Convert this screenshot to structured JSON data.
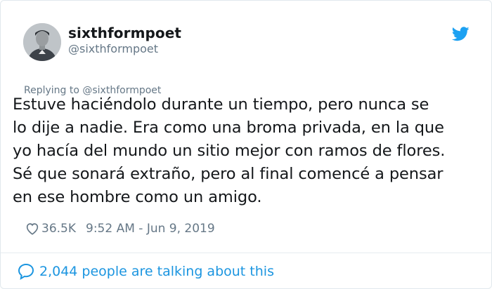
{
  "tweet": {
    "author": {
      "display_name": "sixthformpoet",
      "handle": "@sixthformpoet"
    },
    "replying_to": "Replying to @sixthformpoet",
    "text_lines": [
      "Estuve haciéndolo durante un tiempo, pero nunca se",
      "lo dije a nadie. Era como una broma privada, en la que",
      "yo hacía del mundo un sitio mejor con ramos de flores.",
      "Sé que sonará extraño, pero al final comencé a pensar",
      "en ese hombre como un amigo."
    ],
    "likes": "36.5K",
    "timestamp": "9:52 AM - Jun 9, 2019",
    "conversation": "2,044 people are talking about this"
  },
  "icons": {
    "brand": "twitter-bird-icon",
    "like": "heart-icon",
    "reply": "speech-bubble-icon"
  },
  "colors": {
    "twitter_blue": "#1da1f2",
    "link_blue": "#1b95e0",
    "secondary_text": "#657786",
    "primary_text": "#14171a"
  }
}
